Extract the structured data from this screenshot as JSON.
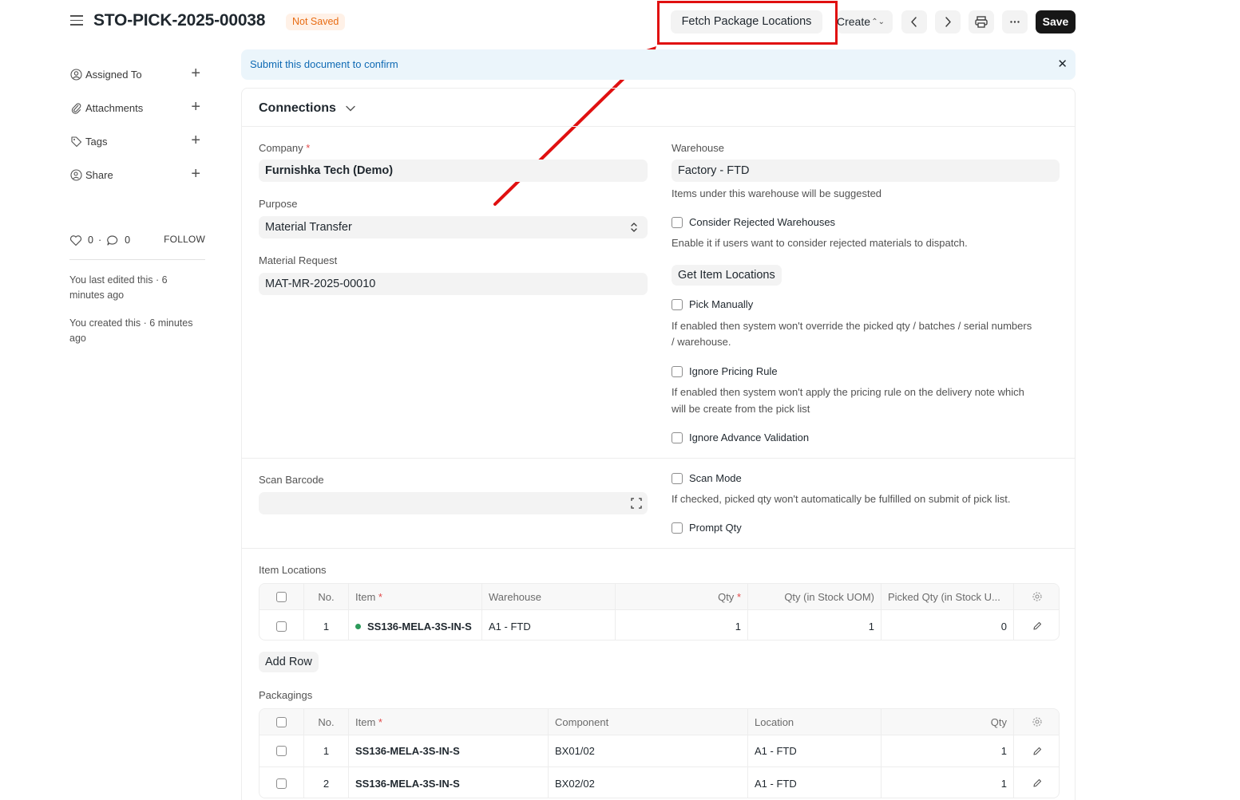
{
  "header": {
    "title": "STO-PICK-2025-00038",
    "status": "Not Saved",
    "fetch_button": "Fetch Package Locations",
    "create_button": "Create",
    "save_button": "Save"
  },
  "sidebar": {
    "items": [
      {
        "label": "Assigned To",
        "icon": "user-add-icon"
      },
      {
        "label": "Attachments",
        "icon": "paperclip-icon"
      },
      {
        "label": "Tags",
        "icon": "tag-icon"
      },
      {
        "label": "Share",
        "icon": "share-icon"
      }
    ],
    "likes": "0",
    "comments": "0",
    "follow": "FOLLOW",
    "activity": [
      "You last edited this · 6 minutes ago",
      "You created this · 6 minutes ago"
    ]
  },
  "banner": {
    "text": "Submit this document to confirm"
  },
  "connections": {
    "title": "Connections"
  },
  "form": {
    "company_label": "Company",
    "company_value": "Furnishka Tech (Demo)",
    "purpose_label": "Purpose",
    "purpose_value": "Material Transfer",
    "material_request_label": "Material Request",
    "material_request_value": "MAT-MR-2025-00010",
    "warehouse_label": "Warehouse",
    "warehouse_value": "Factory - FTD",
    "warehouse_desc": "Items under this warehouse will be suggested",
    "consider_rejected_label": "Consider Rejected Warehouses",
    "consider_rejected_desc": "Enable it if users want to consider rejected materials to dispatch.",
    "get_item_locations": "Get Item Locations",
    "pick_manually_label": "Pick Manually",
    "pick_manually_desc_1": "If enabled then system won't override the picked qty / batches / serial numbers",
    "pick_manually_desc_2": "/ warehouse.",
    "ignore_pricing_label": "Ignore Pricing Rule",
    "ignore_pricing_desc_1": "If enabled then system won't apply the pricing rule on the delivery note which",
    "ignore_pricing_desc_2": "will be create from the pick list",
    "ignore_advance_label": "Ignore Advance Validation",
    "scan_barcode_label": "Scan Barcode",
    "scan_mode_label": "Scan Mode",
    "scan_mode_desc": "If checked, picked qty won't automatically be fulfilled on submit of pick list.",
    "prompt_qty_label": "Prompt Qty"
  },
  "item_locations": {
    "title": "Item Locations",
    "headers": [
      "No.",
      "Item",
      "Warehouse",
      "Qty",
      "Qty (in Stock UOM)",
      "Picked Qty (in Stock U..."
    ],
    "rows": [
      {
        "no": "1",
        "item": "SS136-MELA-3S-IN-S",
        "warehouse": "A1 - FTD",
        "qty": "1",
        "stock_qty": "1",
        "picked": "0"
      }
    ],
    "add_row": "Add Row"
  },
  "packagings": {
    "title": "Packagings",
    "headers": [
      "No.",
      "Item",
      "Component",
      "Location",
      "Qty"
    ],
    "rows": [
      {
        "no": "1",
        "item": "SS136-MELA-3S-IN-S",
        "component": "BX01/02",
        "location": "A1 - FTD",
        "qty": "1"
      },
      {
        "no": "2",
        "item": "SS136-MELA-3S-IN-S",
        "component": "BX02/02",
        "location": "A1 - FTD",
        "qty": "1"
      }
    ]
  },
  "colors": {
    "annotation": "#e01010",
    "primary": "#171717",
    "banner_text": "#0f6ab4",
    "status": "#e86c13"
  }
}
